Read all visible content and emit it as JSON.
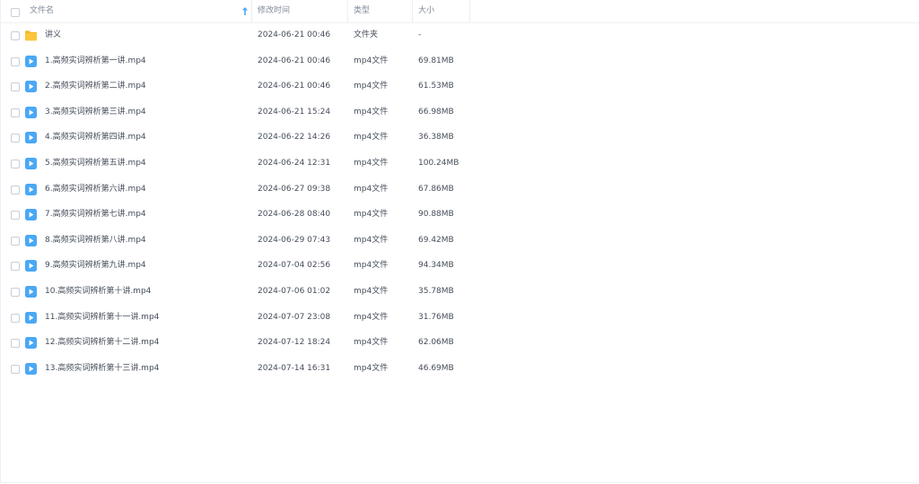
{
  "header": {
    "name_label": "文件名",
    "time_label": "修改时间",
    "type_label": "类型",
    "size_label": "大小"
  },
  "files": [
    {
      "kind": "folder",
      "name": "讲义",
      "modified": "2024-06-21 00:46",
      "type": "文件夹",
      "size": "-"
    },
    {
      "kind": "video",
      "name": "1.高频实词辨析第一讲.mp4",
      "modified": "2024-06-21 00:46",
      "type": "mp4文件",
      "size": "69.81MB"
    },
    {
      "kind": "video",
      "name": "2.高频实词辨析第二讲.mp4",
      "modified": "2024-06-21 00:46",
      "type": "mp4文件",
      "size": "61.53MB"
    },
    {
      "kind": "video",
      "name": "3.高频实词辨析第三讲.mp4",
      "modified": "2024-06-21 15:24",
      "type": "mp4文件",
      "size": "66.98MB"
    },
    {
      "kind": "video",
      "name": "4.高频实词辨析第四讲.mp4",
      "modified": "2024-06-22 14:26",
      "type": "mp4文件",
      "size": "36.38MB"
    },
    {
      "kind": "video",
      "name": "5.高频实词辨析第五讲.mp4",
      "modified": "2024-06-24 12:31",
      "type": "mp4文件",
      "size": "100.24MB"
    },
    {
      "kind": "video",
      "name": "6.高频实词辨析第六讲.mp4",
      "modified": "2024-06-27 09:38",
      "type": "mp4文件",
      "size": "67.86MB"
    },
    {
      "kind": "video",
      "name": "7.高频实词辨析第七讲.mp4",
      "modified": "2024-06-28 08:40",
      "type": "mp4文件",
      "size": "90.88MB"
    },
    {
      "kind": "video",
      "name": "8.高频实词辨析第八讲.mp4",
      "modified": "2024-06-29 07:43",
      "type": "mp4文件",
      "size": "69.42MB"
    },
    {
      "kind": "video",
      "name": "9.高频实词辨析第九讲.mp4",
      "modified": "2024-07-04 02:56",
      "type": "mp4文件",
      "size": "94.34MB"
    },
    {
      "kind": "video",
      "name": "10.高频实词辨析第十讲.mp4",
      "modified": "2024-07-06 01:02",
      "type": "mp4文件",
      "size": "35.78MB"
    },
    {
      "kind": "video",
      "name": "11.高频实词辨析第十一讲.mp4",
      "modified": "2024-07-07 23:08",
      "type": "mp4文件",
      "size": "31.76MB"
    },
    {
      "kind": "video",
      "name": "12.高频实词辨析第十二讲.mp4",
      "modified": "2024-07-12 18:24",
      "type": "mp4文件",
      "size": "62.06MB"
    },
    {
      "kind": "video",
      "name": "13.高频实词辨析第十三讲.mp4",
      "modified": "2024-07-14 16:31",
      "type": "mp4文件",
      "size": "46.69MB"
    }
  ],
  "icons": {
    "folder": "folder-icon",
    "video": "video-file-icon",
    "sort": "sort-ascending-icon"
  },
  "colors": {
    "accent": "#4aa8f5",
    "folder": "#fcc63a",
    "text": "#454d5a",
    "header_text": "#818999"
  }
}
